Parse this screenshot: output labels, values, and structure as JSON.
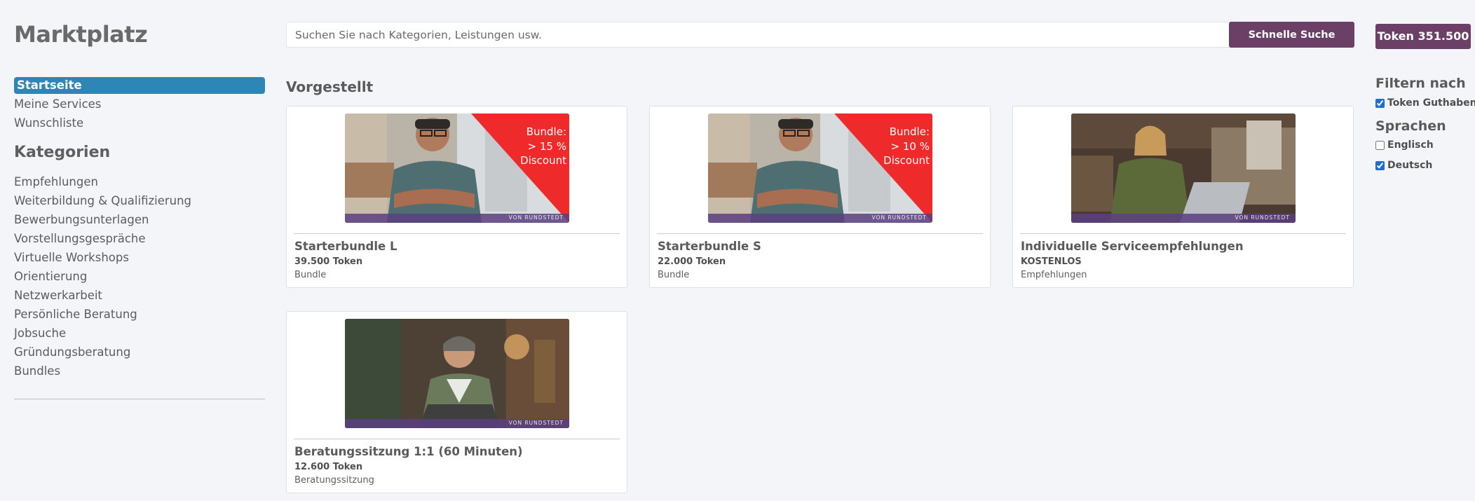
{
  "app": {
    "title": "Marktplatz"
  },
  "nav": {
    "items": [
      {
        "label": "Startseite",
        "active": true
      },
      {
        "label": "Meine Services",
        "active": false
      },
      {
        "label": "Wunschliste",
        "active": false
      }
    ]
  },
  "categories": {
    "heading": "Kategorien",
    "items": [
      "Empfehlungen",
      "Weiterbildung & Qualifizierung",
      "Bewerbungsunterlagen",
      "Vorstellungsgespräche",
      "Virtuelle Workshops",
      "Orientierung",
      "Netzwerkarbeit",
      "Persönliche Beratung",
      "Jobsuche",
      "Gründungsberatung",
      "Bundles"
    ]
  },
  "search": {
    "placeholder": "Suchen Sie nach Kategorien, Leistungen usw.",
    "value": "",
    "button_label": "Schnelle Suche"
  },
  "token_badge": "Token 351.500",
  "featured": {
    "heading": "Vorgestellt",
    "cards": [
      {
        "title": "Starterbundle L",
        "price": "39.500 Token",
        "type": "Bundle",
        "image": "man-glasses-bundle",
        "overlay": [
          "Bundle:",
          "> 15 %",
          "Discount"
        ],
        "brand": "VON RUNDSTEDT"
      },
      {
        "title": "Starterbundle S",
        "price": "22.000 Token",
        "type": "Bundle",
        "image": "man-glasses-bundle",
        "overlay": [
          "Bundle:",
          "> 10 %",
          "Discount"
        ],
        "brand": "VON RUNDSTEDT"
      },
      {
        "title": "Individuelle Serviceempfehlungen",
        "price": "KOSTENLOS",
        "type": "Empfehlungen",
        "image": "woman-laptop-cafe",
        "brand": "VON RUNDSTEDT"
      },
      {
        "title": "Beratungssitzung 1:1 (60 Minuten)",
        "price": "12.600 Token",
        "type": "Beratungssitzung",
        "image": "man-laptop-home",
        "brand": "VON RUNDSTEDT"
      }
    ]
  },
  "filters": {
    "heading": "Filtern nach",
    "token_label": "Token Guthaben",
    "token_checked": true,
    "languages_heading": "Sprachen",
    "languages": [
      {
        "label": "Englisch",
        "checked": false
      },
      {
        "label": "Deutsch",
        "checked": true
      }
    ]
  },
  "colors": {
    "accent_nav": "#2d86b5",
    "primary_button": "#6b3f66",
    "discount_red": "#ee2a2a",
    "brand_band": "#5b3f80"
  }
}
